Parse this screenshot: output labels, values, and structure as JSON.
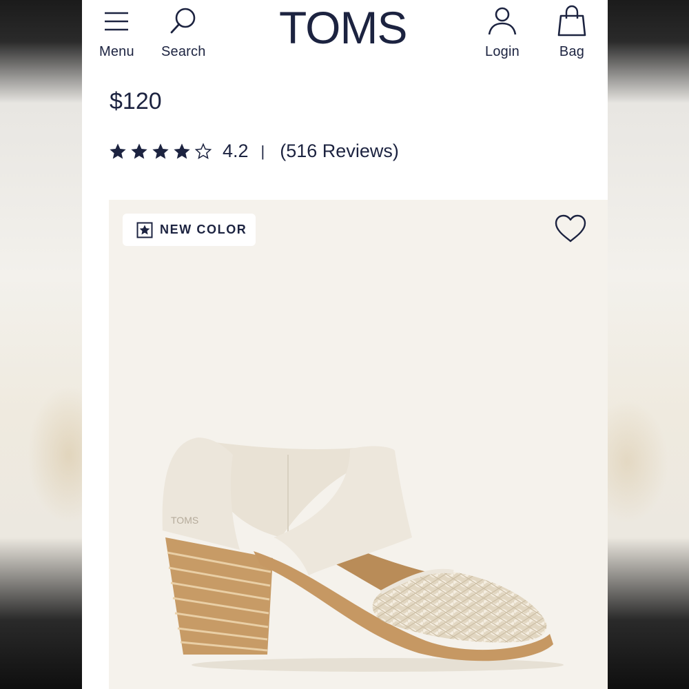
{
  "header": {
    "brand": "TOMS",
    "menu_label": "Menu",
    "search_label": "Search",
    "login_label": "Login",
    "bag_label": "Bag"
  },
  "product": {
    "price": "$120",
    "rating": {
      "stars_filled": 4,
      "stars_total": 5,
      "value": "4.2",
      "separator": "|",
      "reviews_text": "(516 Reviews)"
    },
    "badge": "NEW COLOR",
    "image": {
      "icon": "wishlist-heart-icon",
      "logo_on_shoe": "TOMS"
    }
  },
  "colors": {
    "navy": "#1c2340",
    "hero_bg": "#f5f2ec"
  }
}
